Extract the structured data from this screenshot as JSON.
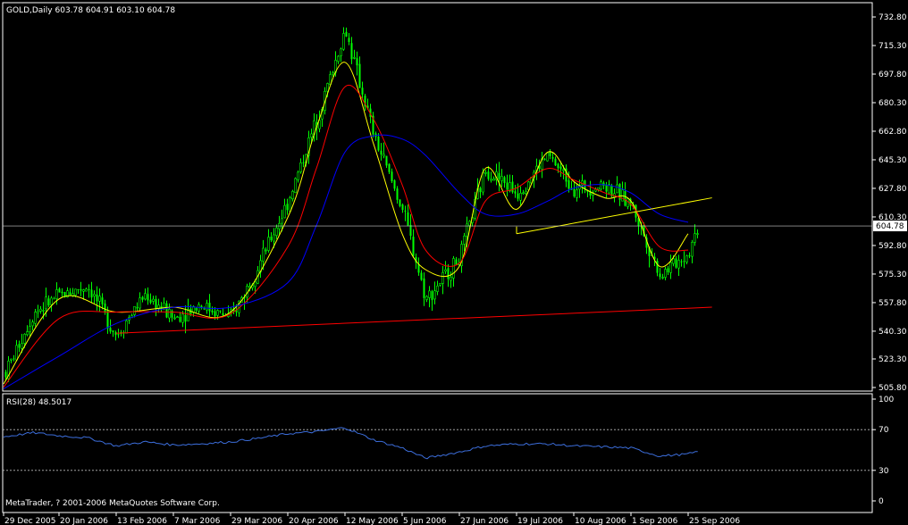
{
  "header": {
    "symbol_line": "GOLD,Daily  603.78 604.91 603.10 604.78"
  },
  "rsi": {
    "label": "RSI(28) 48.5017",
    "levels": [
      70,
      30
    ],
    "scale_labels": [
      "100",
      "70",
      "30",
      "0"
    ]
  },
  "footer": {
    "copyright": "MetaTrader, ? 2001-2006 MetaQuotes Software Corp."
  },
  "colors": {
    "background": "#000000",
    "axis": "#ffffff",
    "candle": "#00ff00",
    "ma_fast": "#ffff00",
    "ma_mid": "#ff0000",
    "ma_slow": "#0000ff",
    "trend_upper": "#ffff00",
    "trend_lower": "#ff0000",
    "rsi_line": "#3c6edc",
    "rsi_level": "#bbbbbb"
  },
  "chart_data": [
    {
      "type": "candlestick",
      "title": "GOLD,Daily",
      "ohlc_last": {
        "open": 603.78,
        "high": 604.91,
        "low": 603.1,
        "close": 604.78
      },
      "current_price_label": "604.78",
      "y_ticks": [
        "732.80",
        "715.30",
        "697.80",
        "680.30",
        "662.80",
        "645.30",
        "627.80",
        "610.30",
        "592.80",
        "575.30",
        "557.80",
        "540.30",
        "523.30",
        "505.80"
      ],
      "ylim": [
        505.8,
        732.8
      ],
      "x_ticks": [
        "29 Dec 2005",
        "20 Jan 2006",
        "13 Feb 2006",
        "7 Mar 2006",
        "29 Mar 2006",
        "20 Apr 2006",
        "12 May 2006",
        "5 Jun 2006",
        "27 Jun 2006",
        "19 Jul 2006",
        "10 Aug 2006",
        "1 Sep 2006",
        "25 Sep 2006"
      ],
      "close_path": {
        "x": [
          "29 Dec 2005",
          "10 Jan 2006",
          "20 Jan 2006",
          "1 Feb 2006",
          "13 Feb 2006",
          "24 Feb 2006",
          "7 Mar 2006",
          "17 Mar 2006",
          "29 Mar 2006",
          "10 Apr 2006",
          "20 Apr 2006",
          "1 May 2006",
          "12 May 2006",
          "24 May 2006",
          "5 Jun 2006",
          "14 Jun 2006",
          "27 Jun 2006",
          "7 Jul 2006",
          "19 Jul 2006",
          "31 Jul 2006",
          "10 Aug 2006",
          "22 Aug 2006",
          "1 Sep 2006",
          "13 Sep 2006",
          "25 Sep 2006",
          "29 Sep 2006"
        ],
        "y": [
          513,
          552,
          562,
          568,
          538,
          563,
          548,
          557,
          548,
          585,
          620,
          670,
          725,
          660,
          615,
          560,
          585,
          640,
          625,
          648,
          628,
          630,
          618,
          575,
          588,
          604.78
        ]
      },
      "moving_averages": [
        {
          "x": [
            "29 Dec 2005",
            "20 Jan 2006",
            "13 Feb 2006",
            "7 Mar 2006",
            "29 Mar 2006",
            "20 Apr 2006",
            "1 May 2006",
            "12 May 2006",
            "24 May 2006",
            "5 Jun 2006",
            "14 Jun 2006",
            "27 Jun 2006",
            "7 Jul 2006",
            "19 Jul 2006",
            "31 Jul 2006",
            "10 Aug 2006",
            "22 Aug 2006",
            "1 Sep 2006",
            "13 Sep 2006",
            "25 Sep 2006"
          ],
          "y": [
            508,
            560,
            552,
            555,
            552,
            610,
            665,
            705,
            655,
            600,
            578,
            580,
            640,
            615,
            650,
            632,
            622,
            620,
            580,
            600
          ]
        },
        {
          "x": [
            "29 Dec 2005",
            "20 Jan 2006",
            "13 Feb 2006",
            "7 Mar 2006",
            "29 Mar 2006",
            "20 Apr 2006",
            "1 May 2006",
            "12 May 2006",
            "24 May 2006",
            "5 Jun 2006",
            "14 Jun 2006",
            "27 Jun 2006",
            "7 Jul 2006",
            "19 Jul 2006",
            "31 Jul 2006",
            "10 Aug 2006",
            "22 Aug 2006",
            "1 Sep 2006",
            "13 Sep 2006",
            "25 Sep 2006"
          ],
          "y": [
            506,
            548,
            552,
            552,
            551,
            592,
            640,
            690,
            670,
            630,
            590,
            582,
            620,
            628,
            640,
            633,
            625,
            618,
            592,
            590
          ]
        },
        {
          "x": [
            "29 Dec 2005",
            "20 Jan 2006",
            "13 Feb 2006",
            "7 Mar 2006",
            "29 Mar 2006",
            "20 Apr 2006",
            "1 May 2006",
            "12 May 2006",
            "24 May 2006",
            "5 Jun 2006",
            "14 Jun 2006",
            "27 Jun 2006",
            "7 Jul 2006",
            "19 Jul 2006",
            "31 Jul 2006",
            "10 Aug 2006",
            "22 Aug 2006",
            "1 Sep 2006",
            "13 Sep 2006",
            "25 Sep 2006"
          ],
          "y": [
            505,
            525,
            545,
            555,
            555,
            570,
            605,
            650,
            660,
            658,
            648,
            625,
            612,
            612,
            620,
            628,
            630,
            625,
            612,
            607
          ]
        }
      ],
      "trendlines": [
        {
          "x": [
            "13 Feb 2006",
            "5 Oct 2006"
          ],
          "y": [
            539,
            555
          ]
        },
        {
          "x": [
            "19 Jul 2006",
            "5 Oct 2006"
          ],
          "y": [
            600,
            622
          ]
        }
      ]
    },
    {
      "type": "line",
      "title": "RSI(28) 48.5017",
      "ylim": [
        0,
        100
      ],
      "y_ticks": [
        "100",
        "70",
        "30",
        "0"
      ],
      "x": [
        "29 Dec 2005",
        "10 Jan 2006",
        "20 Jan 2006",
        "1 Feb 2006",
        "13 Feb 2006",
        "24 Feb 2006",
        "7 Mar 2006",
        "17 Mar 2006",
        "29 Mar 2006",
        "10 Apr 2006",
        "20 Apr 2006",
        "1 May 2006",
        "12 May 2006",
        "24 May 2006",
        "5 Jun 2006",
        "14 Jun 2006",
        "27 Jun 2006",
        "7 Jul 2006",
        "19 Jul 2006",
        "31 Jul 2006",
        "10 Aug 2006",
        "22 Aug 2006",
        "1 Sep 2006",
        "13 Sep 2006",
        "25 Sep 2006",
        "29 Sep 2006"
      ],
      "values": [
        63,
        67,
        64,
        62,
        54,
        58,
        55,
        56,
        58,
        62,
        66,
        68,
        72,
        60,
        52,
        42,
        48,
        54,
        56,
        56,
        54,
        53,
        52,
        44,
        46,
        48.5
      ]
    }
  ]
}
